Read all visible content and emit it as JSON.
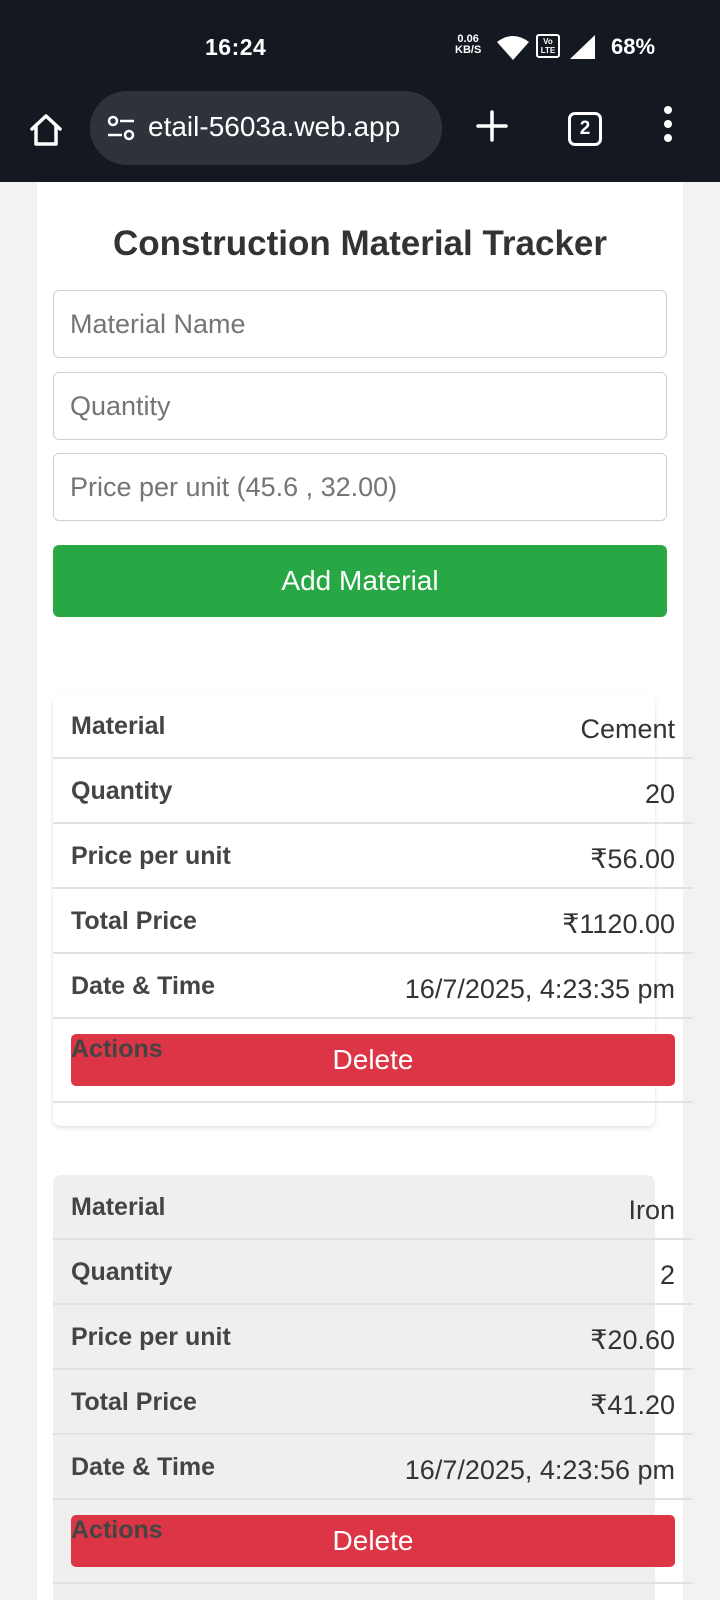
{
  "statusbar": {
    "time": "16:24",
    "net_speed": "0.06",
    "net_unit": "KB/S",
    "volte_top": "Vo",
    "volte_bottom": "LTE",
    "battery": "68%",
    "icons": [
      "wifi-icon",
      "volte-icon",
      "signal-icon"
    ]
  },
  "browser": {
    "url": "etail-5603a.web.app",
    "tab_count": "2",
    "icons": [
      "home-icon",
      "site-settings-icon",
      "new-tab-icon",
      "tab-switcher-icon",
      "menu-icon"
    ]
  },
  "app": {
    "title": "Construction Material Tracker",
    "form": {
      "material_placeholder": "Material Name",
      "quantity_placeholder": "Quantity",
      "price_placeholder": "Price per unit (45.6 , 32.00)",
      "add_label": "Add Material"
    },
    "labels": {
      "material": "Material",
      "quantity": "Quantity",
      "price": "Price per unit",
      "total": "Total Price",
      "datetime": "Date & Time",
      "actions": "Actions",
      "delete": "Delete"
    },
    "materials": [
      {
        "material": "Cement",
        "quantity": "20",
        "price": "₹56.00",
        "total": "₹1120.00",
        "datetime": "16/7/2025, 4:23:35 pm"
      },
      {
        "material": "Iron",
        "quantity": "2",
        "price": "₹20.60",
        "total": "₹41.20",
        "datetime": "16/7/2025, 4:23:56 pm"
      }
    ]
  },
  "colors": {
    "add_button": "#28a745",
    "delete_button": "#dc3545",
    "chrome_bg": "#141820"
  }
}
